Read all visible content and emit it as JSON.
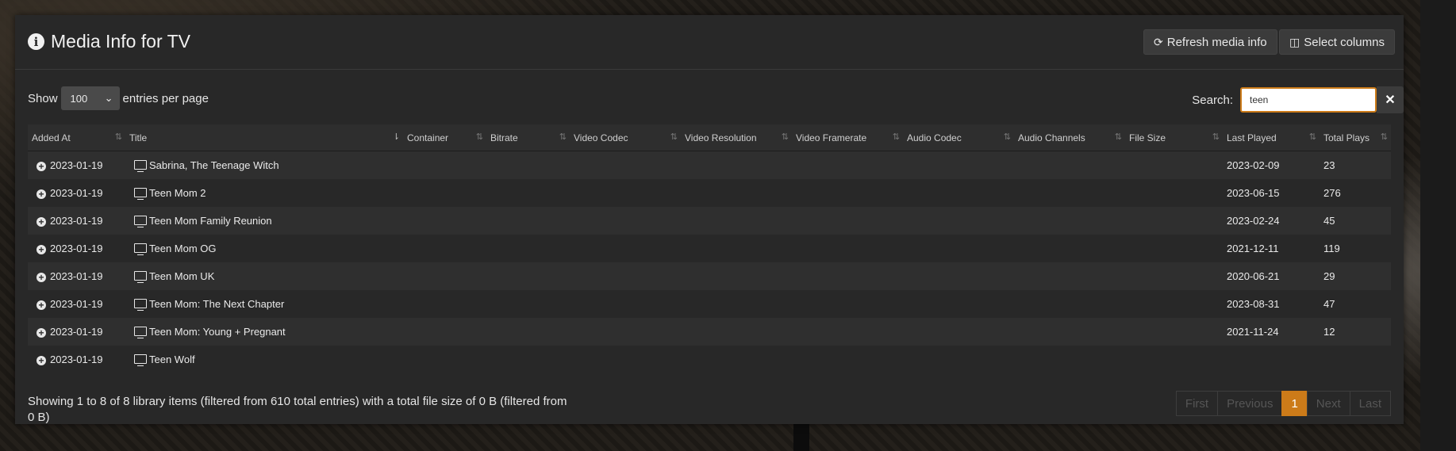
{
  "panel": {
    "title": "Media Info for TV",
    "refresh_label": "Refresh media info",
    "select_columns_label": "Select columns"
  },
  "controls": {
    "show_label": "Show",
    "entries_value": "100",
    "per_page_label": "entries per page",
    "search_label": "Search:",
    "search_value": "teen"
  },
  "columns": [
    "Added At",
    "Title",
    "Container",
    "Bitrate",
    "Video Codec",
    "Video Resolution",
    "Video Framerate",
    "Audio Codec",
    "Audio Channels",
    "File Size",
    "Last Played",
    "Total Plays"
  ],
  "rows": [
    {
      "added": "2023-01-19",
      "title": "Sabrina, The Teenage Witch",
      "last_played": "2023-02-09",
      "plays": "23"
    },
    {
      "added": "2023-01-19",
      "title": "Teen Mom 2",
      "last_played": "2023-06-15",
      "plays": "276"
    },
    {
      "added": "2023-01-19",
      "title": "Teen Mom Family Reunion",
      "last_played": "2023-02-24",
      "plays": "45"
    },
    {
      "added": "2023-01-19",
      "title": "Teen Mom OG",
      "last_played": "2021-12-11",
      "plays": "119"
    },
    {
      "added": "2023-01-19",
      "title": "Teen Mom UK",
      "last_played": "2020-06-21",
      "plays": "29"
    },
    {
      "added": "2023-01-19",
      "title": "Teen Mom: The Next Chapter",
      "last_played": "2023-08-31",
      "plays": "47"
    },
    {
      "added": "2023-01-19",
      "title": "Teen Mom: Young + Pregnant",
      "last_played": "2021-11-24",
      "plays": "12"
    },
    {
      "added": "2023-01-19",
      "title": "Teen Wolf",
      "last_played": "",
      "plays": ""
    }
  ],
  "footer": {
    "summary": "Showing 1 to 8 of 8 library items (filtered from 610 total entries) with a total file size of 0 B (filtered from 0 B)"
  },
  "pagination": {
    "first": "First",
    "previous": "Previous",
    "current": "1",
    "next": "Next",
    "last": "Last"
  },
  "colors": {
    "accent": "#cc7b19",
    "panel_bg": "#282828"
  },
  "icons": {
    "info": "info-circle-icon",
    "refresh": "refresh-icon",
    "columns": "columns-icon",
    "expand": "plus-circle-icon",
    "media": "tv-icon",
    "clear": "close-icon"
  }
}
